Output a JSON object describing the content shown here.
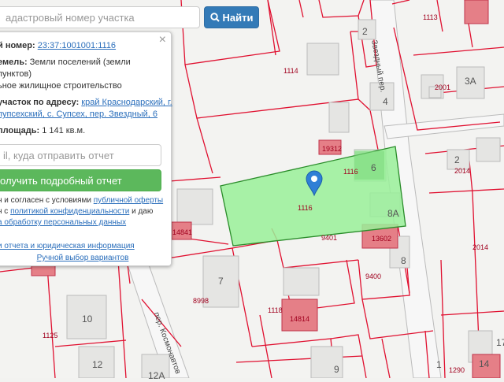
{
  "search": {
    "placeholder": "адастровый номер участка",
    "button_label": "Найти"
  },
  "popup": {
    "number_label": "й номер:",
    "number_value": "23:37:1001001:1116",
    "category_line1_label": "емель:",
    "category_line1_value": "Земли поселений (земли",
    "category_line2": "пунктов)",
    "purpose_line": "ьное жилищное строительство",
    "address_label": "участок по адресу:",
    "address_line1": "край Краснодарский, г.",
    "address_line2": "пупсехский, с. Супсех, пер. Звездный, 6",
    "area_label": "площадь:",
    "area_value": "1 141 кв.м.",
    "email_placeholder": "il, куда отправить отчет",
    "report_button": "олучить подробный отчет",
    "consent_line1_text": "н и согласен с условиями",
    "consent_line1_link": "публичной оферты",
    "consent_line2_text": "н с",
    "consent_line2_link": "политикой конфиденциальности",
    "consent_line2_tail": "и даю",
    "consent_line3_link": "а обработку персональных данных",
    "sample_link": "и отчета и юридическая информация",
    "manual_link": "Ручной выбор вариантов",
    "close_symbol": "×"
  },
  "map": {
    "parcel_labels": [
      "1113",
      "1114",
      "2001",
      "2014",
      "2014",
      "1116",
      "1116",
      "19312",
      "14841",
      "9401",
      "13602",
      "9400",
      "8998",
      "1118",
      "14814",
      "1125",
      "1290"
    ],
    "house_numbers": [
      "2",
      "4",
      "3А",
      "6",
      "2",
      "8А",
      "8",
      "7",
      "10",
      "12",
      "12А",
      "9",
      "14",
      "1",
      "17"
    ],
    "streets": [
      "Звездный пер.",
      "пер. Космонавтов"
    ],
    "selected_color": "#99f099",
    "boundary_color": "#e01030",
    "building_color": "#e57f87",
    "marker_color": "#2f7fd6"
  }
}
